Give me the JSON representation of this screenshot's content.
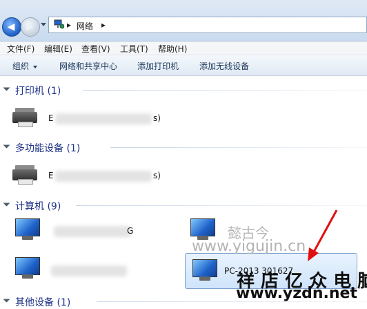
{
  "address_bar": {
    "path": [
      "网络"
    ]
  },
  "menu": {
    "items": [
      "文件(F)",
      "编辑(E)",
      "查看(V)",
      "工具(T)",
      "帮助(H)"
    ]
  },
  "toolbar": {
    "items": [
      "组织",
      "网络和共享中心",
      "添加打印机",
      "添加无线设备"
    ]
  },
  "groups": [
    {
      "title": "打印机 (1)",
      "devices": [
        {
          "label_start": "E",
          "label_end": "s)"
        }
      ]
    },
    {
      "title": "多功能设备 (1)",
      "devices": [
        {
          "label_start": "E",
          "label_end": "s)"
        }
      ]
    },
    {
      "title": "计算机 (9)",
      "devices": [
        {
          "label_end": "G"
        },
        {
          "label": ""
        },
        {
          "label": ""
        },
        {
          "label": "PC-2013 301627"
        }
      ]
    },
    {
      "title": "其他设备 (1)",
      "devices": []
    }
  ],
  "watermarks": {
    "text1": "懿古今",
    "text2": "www.yigujin.cn",
    "text3": "祥 店 亿 众 电 脑",
    "text4": "www.yzdn.net"
  },
  "colors": {
    "group_title": "#1e3287",
    "toolbar_text": "#1e395b",
    "selection_border": "#7da2ce"
  }
}
